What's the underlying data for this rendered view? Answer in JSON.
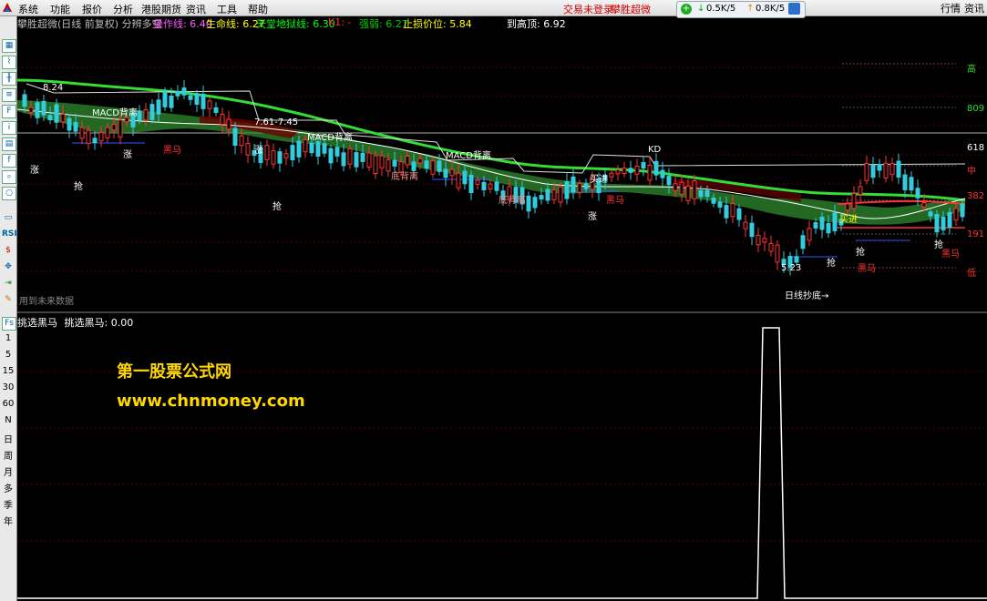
{
  "menu": [
    "系统",
    "功能",
    "报价",
    "分析",
    "港股期货",
    "资讯",
    "工具",
    "帮助"
  ],
  "status": {
    "login": "交易未登录",
    "app": "攀胜超微"
  },
  "net": {
    "down": "0.5K/5",
    "up": "0.8K/5"
  },
  "right_buttons": [
    "行情",
    "资讯"
  ],
  "title": {
    "stock": "攀胜超微(日线 前复权) 分辨多空",
    "line1_label": "操作线: 6.40",
    "line2_label": "生命线: 6.27",
    "line3_label": "天堂地狱线: 6.30",
    "k1_label": "K1: -",
    "strong_label": "强弱: 6.27",
    "stop_label": "止损价位: 5.84",
    "top_label": "到高顶: 6.92"
  },
  "toolbar_periods": [
    "1",
    "5",
    "15",
    "30",
    "60",
    "N",
    "日",
    "周",
    "月",
    "多",
    "季",
    "年"
  ],
  "price_axis": {
    "labels": [
      "高",
      "809",
      "618",
      "中",
      "382",
      "191",
      "低"
    ]
  },
  "annotations": {
    "high_price": "8.24",
    "range": "7.61-7.45",
    "low_price": "5.23",
    "macd1": "MACD背离",
    "macd2": "MACD背离",
    "macd3": "MACD背离",
    "div1": "底背离",
    "div2": "底背离",
    "heima1": "黑马",
    "heima2": "黑马",
    "heima3": "黑马",
    "heima4": "黑马",
    "zhang1": "涨",
    "zhang2": "涨",
    "zhang3": "涨",
    "zhang4": "涨",
    "qiang1": "抢",
    "qiang2": "抢",
    "qiang3": "抢",
    "qiang4": "抢",
    "qiang5": "抢",
    "bottom_arrow": "日线抄底→",
    "mairu1": "买进",
    "mairu2": "买进",
    "kdj": "KD",
    "fade_note": "用到未来数据"
  },
  "indicator": {
    "title": "挑选黑马",
    "value_label": "挑选黑马: 0.00"
  },
  "watermark": {
    "cn": "第一股票公式网",
    "url": "www.chnmoney.com"
  }
}
